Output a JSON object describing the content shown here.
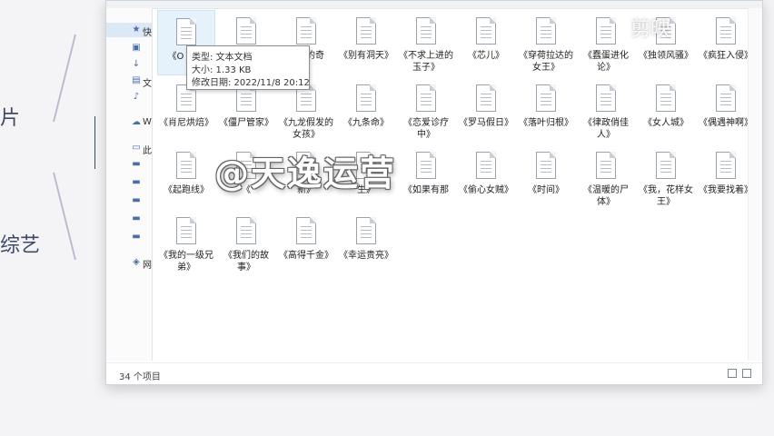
{
  "background": {
    "partial_text_top": "片",
    "partial_text_bottom": "综艺"
  },
  "window": {
    "nav_items": [
      {
        "label": "快",
        "icon": "star-icon"
      },
      {
        "label": "",
        "icon": "image-icon"
      },
      {
        "label": "",
        "icon": "download-icon"
      },
      {
        "label": "文",
        "icon": "document-icon"
      },
      {
        "label": "",
        "icon": "music-icon"
      },
      {
        "label": "W",
        "icon": "cloud-icon"
      },
      {
        "label": "此",
        "icon": "computer-icon"
      },
      {
        "label": "",
        "icon": "folder-icon"
      },
      {
        "label": "",
        "icon": "folder-icon"
      },
      {
        "label": "",
        "icon": "drive-icon"
      },
      {
        "label": "",
        "icon": "drive-icon"
      },
      {
        "label": "",
        "icon": "drive-icon"
      },
      {
        "label": "网",
        "icon": "network-icon"
      }
    ],
    "files": [
      {
        "name": "《O 的偷"
      },
      {
        "name": "《我们"
      },
      {
        "name": "《萌的奇"
      },
      {
        "name": "《别有洞天》"
      },
      {
        "name": "《不求上进的玉子》"
      },
      {
        "name": "《芯儿》"
      },
      {
        "name": "《穿荷拉达的女王》"
      },
      {
        "name": "《蠢蛋进化论》"
      },
      {
        "name": "《独领风骚》"
      },
      {
        "name": "《疯狂入侵》"
      },
      {
        "name": "《肖尼烘焙》"
      },
      {
        "name": "《僵尸管家》"
      },
      {
        "name": "《九龙假发的女孩》"
      },
      {
        "name": "《九条命》"
      },
      {
        "name": "《恋爱诊疗中》"
      },
      {
        "name": "《罗马假日》"
      },
      {
        "name": "《落叶归根》"
      },
      {
        "name": "《律政俏佳人》"
      },
      {
        "name": "《女人城》"
      },
      {
        "name": "《偶遇神啊》"
      },
      {
        "name": "《起跑线》"
      },
      {
        "name": "《"
      },
      {
        "name": "新》"
      },
      {
        "name": "生》"
      },
      {
        "name": "《如果有那"
      },
      {
        "name": "《偷心女贼》"
      },
      {
        "name": "《时间》"
      },
      {
        "name": "《温暖的尸体》"
      },
      {
        "name": "《我，花样女王》"
      },
      {
        "name": "《我要找着》"
      },
      {
        "name": "《我的一级兄弟》"
      },
      {
        "name": "《我们的故事》"
      },
      {
        "name": "《高得千金》"
      },
      {
        "name": "《幸运贵亮》"
      }
    ],
    "tooltip": {
      "type": "类型: 文本文档",
      "size": "大小: 1.33 KB",
      "modified": "修改日期: 2022/11/8 20:12"
    },
    "status": {
      "item_count": "34 个项目"
    }
  },
  "watermark": "@天逸运营",
  "corner_mark": "剪映"
}
